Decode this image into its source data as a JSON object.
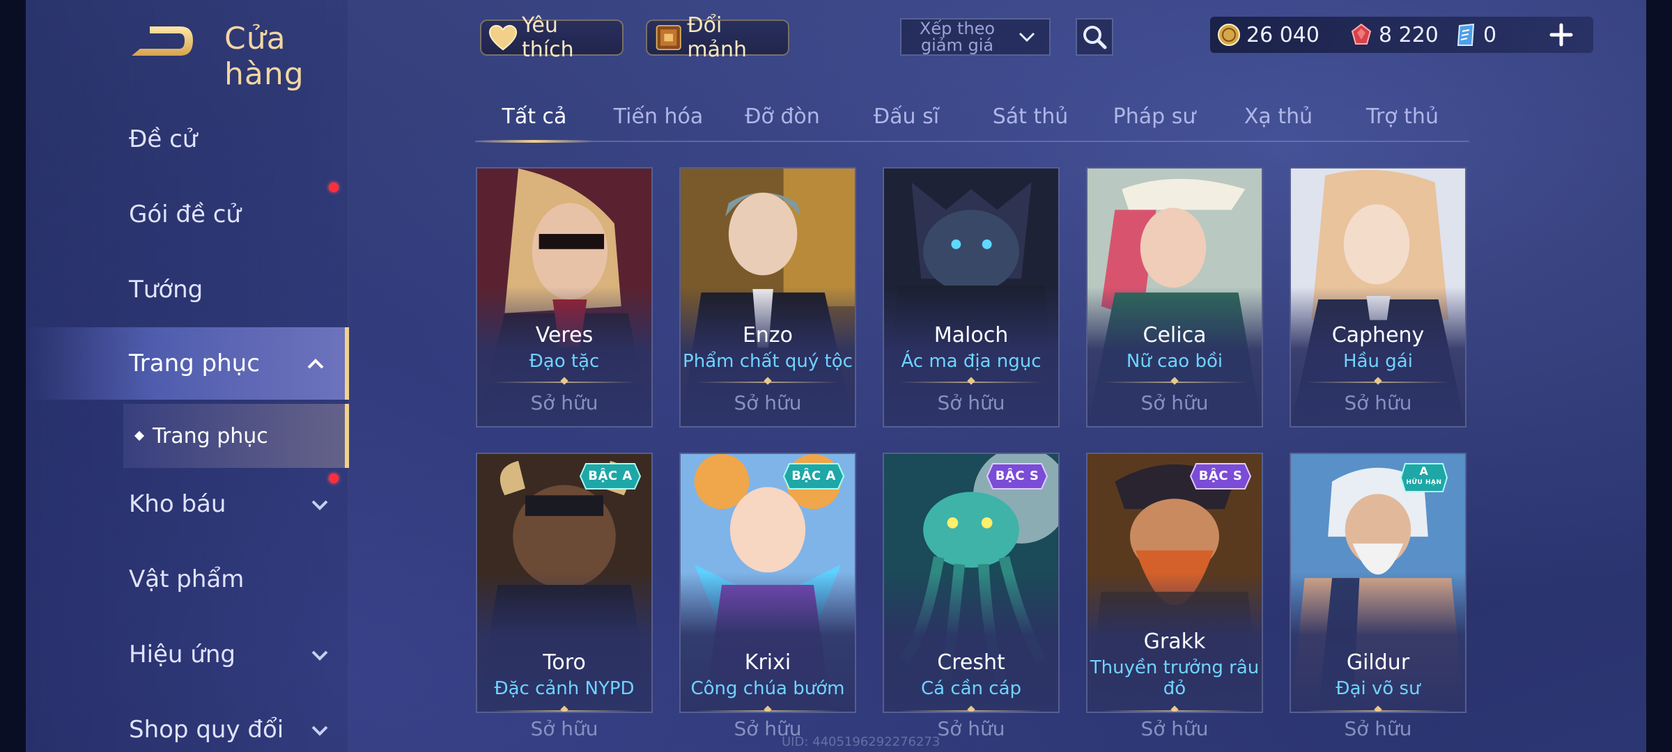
{
  "header": {
    "title": "Cửa hàng"
  },
  "sidebar": {
    "items": [
      {
        "label": "Đề cử"
      },
      {
        "label": "Gói đề cử"
      },
      {
        "label": "Tướng"
      },
      {
        "label": "Trang phục"
      },
      {
        "label": "Kho báu"
      },
      {
        "label": "Vật phẩm"
      },
      {
        "label": "Hiệu ứng"
      },
      {
        "label": "Shop quy đổi"
      }
    ],
    "sub_item": "Trang phục"
  },
  "topbar": {
    "favorites_label": "Yêu thích",
    "exchange_label": "Đổi mảnh",
    "sort_label": "Xếp theo giảm giá",
    "currencies": [
      {
        "icon": "gold-coin-icon",
        "value": "26 040"
      },
      {
        "icon": "ruby-gem-icon",
        "value": "8 220"
      },
      {
        "icon": "voucher-icon",
        "value": "0"
      }
    ]
  },
  "tabs": [
    "Tất cả",
    "Tiến hóa",
    "Đỡ đòn",
    "Đấu sĩ",
    "Sát thủ",
    "Pháp sư",
    "Xạ thủ",
    "Trợ thủ"
  ],
  "active_tab": "Tất cả",
  "cards": [
    {
      "hero": "Veres",
      "skin": "Đạo tặc",
      "status": "Sở hữu"
    },
    {
      "hero": "Enzo",
      "skin": "Phẩm chất quý tộc",
      "status": "Sở hữu"
    },
    {
      "hero": "Maloch",
      "skin": "Ác ma địa ngục",
      "status": "Sở hữu"
    },
    {
      "hero": "Celica",
      "skin": "Nữ cao bồi",
      "status": "Sở hữu"
    },
    {
      "hero": "Capheny",
      "skin": "Hầu gái",
      "status": "Sở hữu"
    },
    {
      "hero": "Toro",
      "skin": "Đặc cảnh NYPD",
      "status": "Sở hữu",
      "badge": "BẬC A"
    },
    {
      "hero": "Krixi",
      "skin": "Công chúa bướm",
      "status": "Sở hữu",
      "badge": "BẬC A"
    },
    {
      "hero": "Cresht",
      "skin": "Cá cần cáp",
      "status": "Sở hữu",
      "badge": "BẬC S"
    },
    {
      "hero": "Grakk",
      "skin": "Thuyền trưởng râu đỏ",
      "status": "Sở hữu",
      "badge": "BẬC S"
    },
    {
      "hero": "Gildur",
      "skin": "Đại võ sư",
      "status": "Sở hữu",
      "badge": "A",
      "badge_sub": "HỮU HẠN"
    }
  ],
  "uid": "UID: 4405196292276273",
  "colors": {
    "accent_gold": "#f1d28c",
    "skin_name_blue": "#6fd3ff",
    "notification_red": "#ff2f3d",
    "badge_a": "#1fa7a7",
    "badge_s": "#7b4cd6"
  }
}
